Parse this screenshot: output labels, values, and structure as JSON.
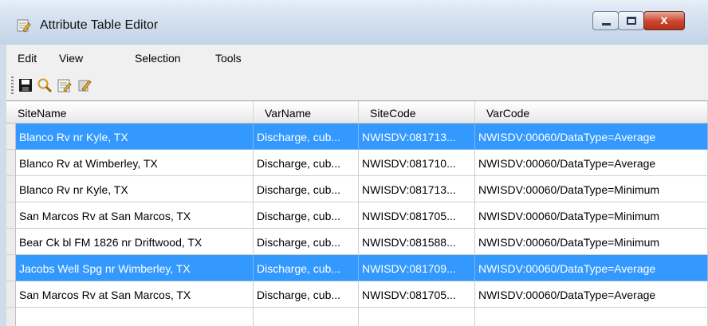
{
  "window": {
    "title": "Attribute Table Editor",
    "close_glyph": "x"
  },
  "menu": [
    "Edit",
    "View",
    "Selection",
    "Tools"
  ],
  "toolbar": [
    "save-icon",
    "search-icon",
    "edit-table-icon",
    "edit-pencil-icon"
  ],
  "columns": [
    "SiteName",
    "VarName",
    "SiteCode",
    "VarCode"
  ],
  "rows": [
    {
      "selected": true,
      "cells": [
        "Blanco Rv nr Kyle, TX",
        "Discharge, cub...",
        "NWISDV:081713...",
        "NWISDV:00060/DataType=Average"
      ]
    },
    {
      "selected": false,
      "cells": [
        "Blanco Rv at Wimberley, TX",
        "Discharge, cub...",
        "NWISDV:081710...",
        "NWISDV:00060/DataType=Average"
      ]
    },
    {
      "selected": false,
      "cells": [
        "Blanco Rv nr Kyle, TX",
        "Discharge, cub...",
        "NWISDV:081713...",
        "NWISDV:00060/DataType=Minimum"
      ]
    },
    {
      "selected": false,
      "cells": [
        "San Marcos Rv at San Marcos, TX",
        "Discharge, cub...",
        "NWISDV:081705...",
        "NWISDV:00060/DataType=Minimum"
      ]
    },
    {
      "selected": false,
      "cells": [
        "Bear Ck bl FM 1826 nr Driftwood, TX",
        "Discharge, cub...",
        "NWISDV:081588...",
        "NWISDV:00060/DataType=Minimum"
      ]
    },
    {
      "selected": true,
      "cells": [
        "Jacobs Well Spg nr Wimberley, TX",
        "Discharge, cub...",
        "NWISDV:081709...",
        "NWISDV:00060/DataType=Average"
      ]
    },
    {
      "selected": false,
      "cells": [
        "San Marcos Rv at San Marcos, TX",
        "Discharge, cub...",
        "NWISDV:081705...",
        "NWISDV:00060/DataType=Average"
      ]
    },
    {
      "selected": false,
      "cells": [
        "",
        "",
        "",
        ""
      ]
    }
  ],
  "colors": {
    "selection": "#3399ff",
    "selection_text": "#ffffff"
  }
}
